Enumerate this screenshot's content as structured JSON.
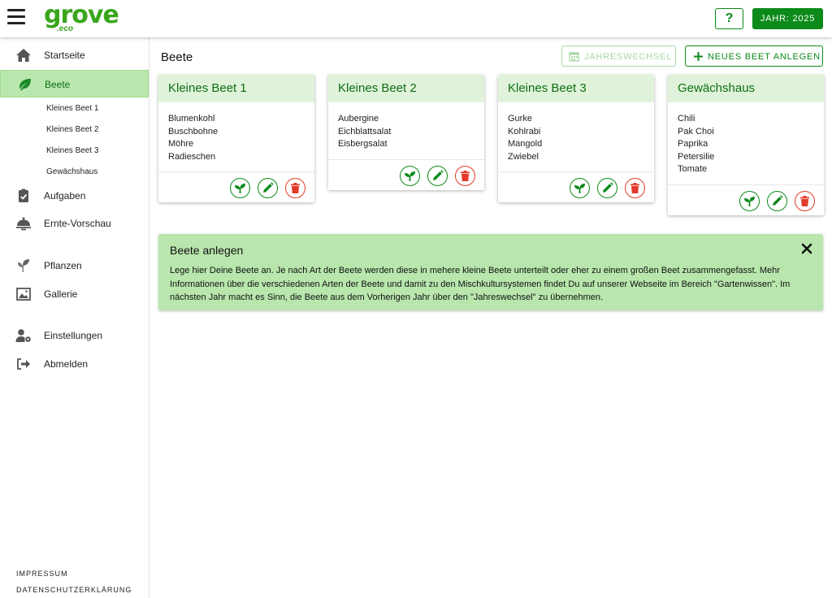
{
  "header": {
    "logo": "grove",
    "logo_sub": ".eco",
    "help_label": "?",
    "year_label": "JAHR: 2025"
  },
  "sidebar": {
    "items": [
      {
        "label": "Startseite",
        "icon": "home-icon"
      },
      {
        "label": "Beete",
        "icon": "leaf-icon",
        "active": true
      },
      {
        "label": "Aufgaben",
        "icon": "clipboard-check-icon"
      },
      {
        "label": "Ernte-Vorschau",
        "icon": "cloche-icon"
      },
      {
        "label": "Pflanzen",
        "icon": "seedling-icon"
      },
      {
        "label": "Gallerie",
        "icon": "gallery-icon"
      },
      {
        "label": "Einstellungen",
        "icon": "user-gear-icon"
      },
      {
        "label": "Abmelden",
        "icon": "logout-icon"
      }
    ],
    "sub_items": [
      "Kleines Beet 1",
      "Kleines Beet 2",
      "Kleines Beet 3",
      "Gewächshaus"
    ],
    "footer": [
      "IMPRESSUM",
      "DATENSCHUTZERKLÄRUNG"
    ]
  },
  "main": {
    "title": "Beete",
    "btn_year_change": "JAHRESWECHSEL",
    "btn_new_bed": "NEUES BEET ANLEGEN",
    "beds": [
      {
        "name": "Kleines Beet 1",
        "plants": [
          "Blumenkohl",
          "Buschbohne",
          "Möhre",
          "Radieschen"
        ]
      },
      {
        "name": "Kleines Beet 2",
        "plants": [
          "Aubergine",
          "Eichblattsalat",
          "Eisbergsalat"
        ]
      },
      {
        "name": "Kleines Beet 3",
        "plants": [
          "Gurke",
          "Kohlrabi",
          "Mangold",
          "Zwiebel"
        ]
      },
      {
        "name": "Gewächshaus",
        "plants": [
          "Chili",
          "Pak Choi",
          "Paprika",
          "Petersilie",
          "Tomate"
        ]
      }
    ],
    "info": {
      "title": "Beete anlegen",
      "text": "Lege hier Deine Beete an. Je nach Art der Beete werden diese in mehere kleine Beete unterteilt oder eher zu einem großen Beet zusammengefasst. Mehr Informationen über die verschiedenen Arten der Beete und damit zu den Mischkultursystemen findet Du auf unserer Webseite im Bereich \"Gartenwissen\". Im nächsten Jahr macht es Sinn, die Beete aus dem Vorherigen Jahr über den \"Jahreswechsel\" zu übernehmen."
    }
  },
  "colors": {
    "brand_green": "#0c8a1a",
    "logo_green": "#3aa61c",
    "active_bg": "#b9e8ae",
    "card_head_bg": "#e0f3da",
    "delete_red": "#e23a2a"
  }
}
